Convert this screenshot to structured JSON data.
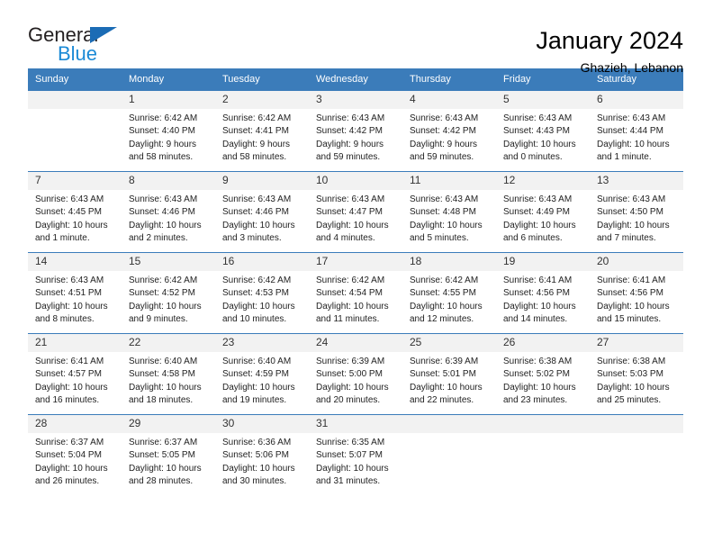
{
  "logo": {
    "text_primary": "General",
    "text_secondary": "Blue",
    "triangle_color": "#1b6cb5",
    "secondary_color": "#1b8ad6"
  },
  "header": {
    "title": "January 2024",
    "subtitle": "Ghazieh, Lebanon"
  },
  "theme": {
    "header_bg": "#3b7cba",
    "daynum_bg": "#f2f2f2",
    "grid_line": "#3b7cba"
  },
  "weekday_headers": [
    "Sunday",
    "Monday",
    "Tuesday",
    "Wednesday",
    "Thursday",
    "Friday",
    "Saturday"
  ],
  "weeks": [
    [
      {
        "day": "",
        "sunrise": "",
        "sunset": "",
        "daylight1": "",
        "daylight2": ""
      },
      {
        "day": "1",
        "sunrise": "Sunrise: 6:42 AM",
        "sunset": "Sunset: 4:40 PM",
        "daylight1": "Daylight: 9 hours",
        "daylight2": "and 58 minutes."
      },
      {
        "day": "2",
        "sunrise": "Sunrise: 6:42 AM",
        "sunset": "Sunset: 4:41 PM",
        "daylight1": "Daylight: 9 hours",
        "daylight2": "and 58 minutes."
      },
      {
        "day": "3",
        "sunrise": "Sunrise: 6:43 AM",
        "sunset": "Sunset: 4:42 PM",
        "daylight1": "Daylight: 9 hours",
        "daylight2": "and 59 minutes."
      },
      {
        "day": "4",
        "sunrise": "Sunrise: 6:43 AM",
        "sunset": "Sunset: 4:42 PM",
        "daylight1": "Daylight: 9 hours",
        "daylight2": "and 59 minutes."
      },
      {
        "day": "5",
        "sunrise": "Sunrise: 6:43 AM",
        "sunset": "Sunset: 4:43 PM",
        "daylight1": "Daylight: 10 hours",
        "daylight2": "and 0 minutes."
      },
      {
        "day": "6",
        "sunrise": "Sunrise: 6:43 AM",
        "sunset": "Sunset: 4:44 PM",
        "daylight1": "Daylight: 10 hours",
        "daylight2": "and 1 minute."
      }
    ],
    [
      {
        "day": "7",
        "sunrise": "Sunrise: 6:43 AM",
        "sunset": "Sunset: 4:45 PM",
        "daylight1": "Daylight: 10 hours",
        "daylight2": "and 1 minute."
      },
      {
        "day": "8",
        "sunrise": "Sunrise: 6:43 AM",
        "sunset": "Sunset: 4:46 PM",
        "daylight1": "Daylight: 10 hours",
        "daylight2": "and 2 minutes."
      },
      {
        "day": "9",
        "sunrise": "Sunrise: 6:43 AM",
        "sunset": "Sunset: 4:46 PM",
        "daylight1": "Daylight: 10 hours",
        "daylight2": "and 3 minutes."
      },
      {
        "day": "10",
        "sunrise": "Sunrise: 6:43 AM",
        "sunset": "Sunset: 4:47 PM",
        "daylight1": "Daylight: 10 hours",
        "daylight2": "and 4 minutes."
      },
      {
        "day": "11",
        "sunrise": "Sunrise: 6:43 AM",
        "sunset": "Sunset: 4:48 PM",
        "daylight1": "Daylight: 10 hours",
        "daylight2": "and 5 minutes."
      },
      {
        "day": "12",
        "sunrise": "Sunrise: 6:43 AM",
        "sunset": "Sunset: 4:49 PM",
        "daylight1": "Daylight: 10 hours",
        "daylight2": "and 6 minutes."
      },
      {
        "day": "13",
        "sunrise": "Sunrise: 6:43 AM",
        "sunset": "Sunset: 4:50 PM",
        "daylight1": "Daylight: 10 hours",
        "daylight2": "and 7 minutes."
      }
    ],
    [
      {
        "day": "14",
        "sunrise": "Sunrise: 6:43 AM",
        "sunset": "Sunset: 4:51 PM",
        "daylight1": "Daylight: 10 hours",
        "daylight2": "and 8 minutes."
      },
      {
        "day": "15",
        "sunrise": "Sunrise: 6:42 AM",
        "sunset": "Sunset: 4:52 PM",
        "daylight1": "Daylight: 10 hours",
        "daylight2": "and 9 minutes."
      },
      {
        "day": "16",
        "sunrise": "Sunrise: 6:42 AM",
        "sunset": "Sunset: 4:53 PM",
        "daylight1": "Daylight: 10 hours",
        "daylight2": "and 10 minutes."
      },
      {
        "day": "17",
        "sunrise": "Sunrise: 6:42 AM",
        "sunset": "Sunset: 4:54 PM",
        "daylight1": "Daylight: 10 hours",
        "daylight2": "and 11 minutes."
      },
      {
        "day": "18",
        "sunrise": "Sunrise: 6:42 AM",
        "sunset": "Sunset: 4:55 PM",
        "daylight1": "Daylight: 10 hours",
        "daylight2": "and 12 minutes."
      },
      {
        "day": "19",
        "sunrise": "Sunrise: 6:41 AM",
        "sunset": "Sunset: 4:56 PM",
        "daylight1": "Daylight: 10 hours",
        "daylight2": "and 14 minutes."
      },
      {
        "day": "20",
        "sunrise": "Sunrise: 6:41 AM",
        "sunset": "Sunset: 4:56 PM",
        "daylight1": "Daylight: 10 hours",
        "daylight2": "and 15 minutes."
      }
    ],
    [
      {
        "day": "21",
        "sunrise": "Sunrise: 6:41 AM",
        "sunset": "Sunset: 4:57 PM",
        "daylight1": "Daylight: 10 hours",
        "daylight2": "and 16 minutes."
      },
      {
        "day": "22",
        "sunrise": "Sunrise: 6:40 AM",
        "sunset": "Sunset: 4:58 PM",
        "daylight1": "Daylight: 10 hours",
        "daylight2": "and 18 minutes."
      },
      {
        "day": "23",
        "sunrise": "Sunrise: 6:40 AM",
        "sunset": "Sunset: 4:59 PM",
        "daylight1": "Daylight: 10 hours",
        "daylight2": "and 19 minutes."
      },
      {
        "day": "24",
        "sunrise": "Sunrise: 6:39 AM",
        "sunset": "Sunset: 5:00 PM",
        "daylight1": "Daylight: 10 hours",
        "daylight2": "and 20 minutes."
      },
      {
        "day": "25",
        "sunrise": "Sunrise: 6:39 AM",
        "sunset": "Sunset: 5:01 PM",
        "daylight1": "Daylight: 10 hours",
        "daylight2": "and 22 minutes."
      },
      {
        "day": "26",
        "sunrise": "Sunrise: 6:38 AM",
        "sunset": "Sunset: 5:02 PM",
        "daylight1": "Daylight: 10 hours",
        "daylight2": "and 23 minutes."
      },
      {
        "day": "27",
        "sunrise": "Sunrise: 6:38 AM",
        "sunset": "Sunset: 5:03 PM",
        "daylight1": "Daylight: 10 hours",
        "daylight2": "and 25 minutes."
      }
    ],
    [
      {
        "day": "28",
        "sunrise": "Sunrise: 6:37 AM",
        "sunset": "Sunset: 5:04 PM",
        "daylight1": "Daylight: 10 hours",
        "daylight2": "and 26 minutes."
      },
      {
        "day": "29",
        "sunrise": "Sunrise: 6:37 AM",
        "sunset": "Sunset: 5:05 PM",
        "daylight1": "Daylight: 10 hours",
        "daylight2": "and 28 minutes."
      },
      {
        "day": "30",
        "sunrise": "Sunrise: 6:36 AM",
        "sunset": "Sunset: 5:06 PM",
        "daylight1": "Daylight: 10 hours",
        "daylight2": "and 30 minutes."
      },
      {
        "day": "31",
        "sunrise": "Sunrise: 6:35 AM",
        "sunset": "Sunset: 5:07 PM",
        "daylight1": "Daylight: 10 hours",
        "daylight2": "and 31 minutes."
      },
      {
        "day": "",
        "sunrise": "",
        "sunset": "",
        "daylight1": "",
        "daylight2": ""
      },
      {
        "day": "",
        "sunrise": "",
        "sunset": "",
        "daylight1": "",
        "daylight2": ""
      },
      {
        "day": "",
        "sunrise": "",
        "sunset": "",
        "daylight1": "",
        "daylight2": ""
      }
    ]
  ]
}
